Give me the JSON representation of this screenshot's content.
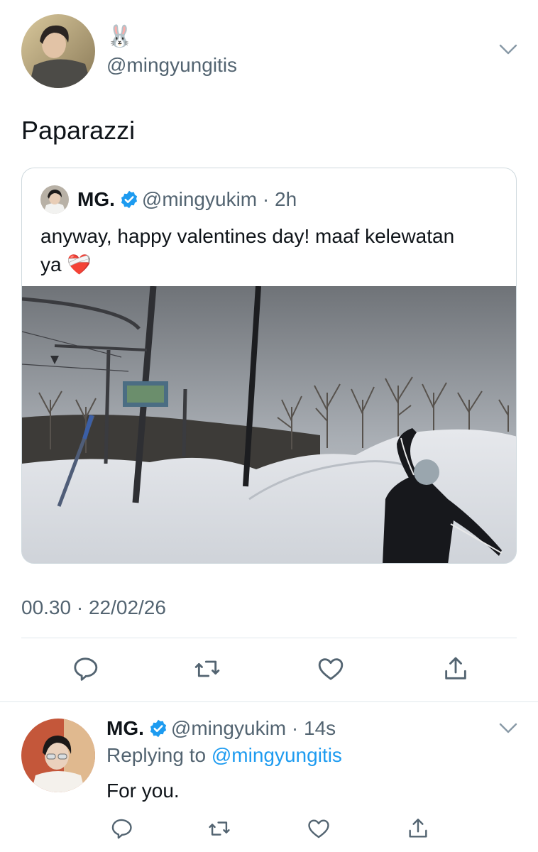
{
  "main_tweet": {
    "display_name_emoji": "🐰",
    "handle": "@mingyungitis",
    "text": "Paparazzi",
    "timestamp": "00.30 · 22/02/26"
  },
  "quoted_tweet": {
    "name": "MG.",
    "handle": "@mingyukim",
    "separator": " · ",
    "time": "2h",
    "text_line1": "anyway, happy valentines day! maaf kelewatan",
    "text_line2": "ya",
    "heart_emoji": "❤️‍🩹"
  },
  "reply_tweet": {
    "name": "MG.",
    "handle": "@mingyukim",
    "separator": " · ",
    "time": "14s",
    "replying_to_label": "Replying to",
    "replying_to_handle": "@mingyungitis",
    "text": "For you."
  },
  "actions": {
    "icons": [
      "reply-icon",
      "retweet-icon",
      "like-icon",
      "share-icon"
    ]
  },
  "colors": {
    "text": "#0f1419",
    "secondary": "#536471",
    "link": "#1d9bf0",
    "verified": "#1d9bf0",
    "border": "#cfd9de"
  }
}
